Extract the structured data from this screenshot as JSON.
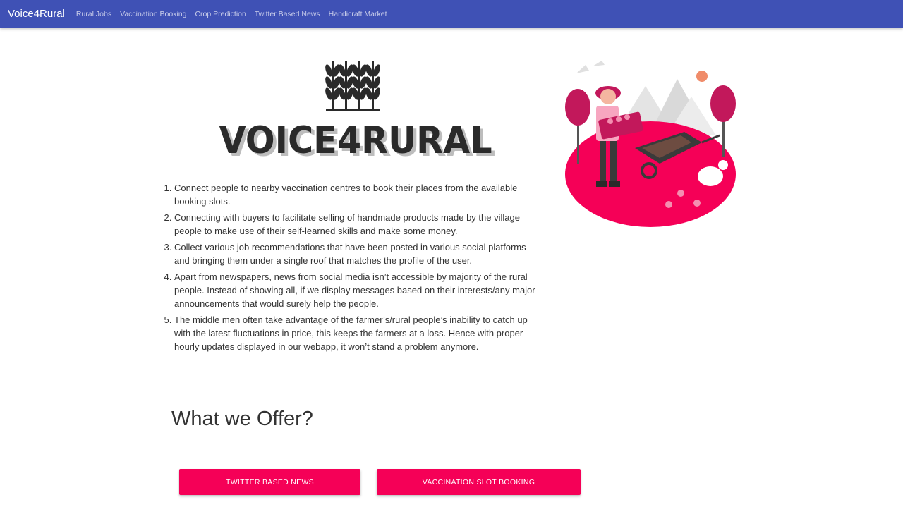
{
  "navbar": {
    "brand": "Voice4Rural",
    "links": [
      "Rural Jobs",
      "Vaccination Booking",
      "Crop Prediction",
      "Twitter Based News",
      "Handicraft Market"
    ],
    "color": "#3f51b5"
  },
  "logo": {
    "text": "VOICE4RURAL",
    "icon": "wheat-icon"
  },
  "illustration": {
    "icon": "farmer-illustration",
    "accent": "#f50057"
  },
  "features": [
    "Connect people to nearby vaccination centres to book their places from the available booking slots.",
    "Connecting with buyers to facilitate selling of handmade products made by the village people to make use of their self-learned skills and make some money.",
    "Collect various job recommendations that have been posted in various social platforms and bringing them under a single roof that matches the profile of the user.",
    "Apart from newspapers, news from social media isn’t accessible by majority of the rural people. Instead of showing all, if we display messages based on their interests/any major announcements that would surely help the people.",
    "The middle men often take advantage of the farmer’s/rural people’s inability to catch up with the latest fluctuations in price, this keeps the farmers at a loss. Hence with proper hourly updates displayed in our webapp, it won’t stand a problem anymore."
  ],
  "offer": {
    "title": "What we Offer?",
    "buttons": [
      "Twitter Based News",
      "Vaccination Slot Booking"
    ],
    "button_color": "#f50057"
  }
}
